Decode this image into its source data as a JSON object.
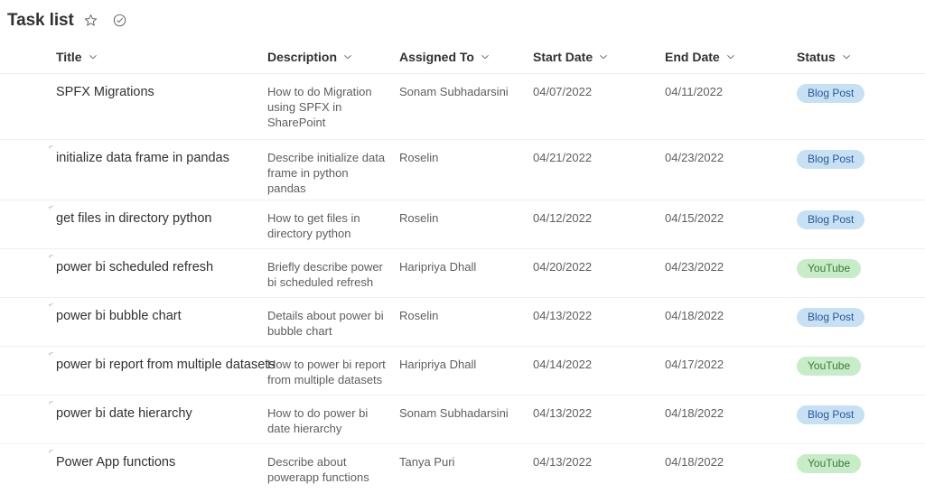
{
  "header": {
    "title": "Task list",
    "favorite_icon": "star-icon",
    "published_icon": "check-circle-icon"
  },
  "table": {
    "columns": [
      {
        "key": "title",
        "label": "Title",
        "sort_icon": "chevron-down-icon"
      },
      {
        "key": "description",
        "label": "Description",
        "sort_icon": "chevron-down-icon"
      },
      {
        "key": "assigned_to",
        "label": "Assigned To",
        "sort_icon": "chevron-down-icon"
      },
      {
        "key": "start_date",
        "label": "Start Date",
        "sort_icon": "chevron-down-icon"
      },
      {
        "key": "end_date",
        "label": "End Date",
        "sort_icon": "chevron-down-icon"
      },
      {
        "key": "status",
        "label": "Status",
        "sort_icon": "chevron-down-icon"
      }
    ],
    "row_marker": "⌐",
    "rows": [
      {
        "title": "SPFX Migrations",
        "has_marker": false,
        "description": "How to do Migration using SPFX in SharePoint",
        "assigned_to": "Sonam Subhadarsini",
        "start_date": "04/07/2022",
        "end_date": "04/11/2022",
        "status": "Blog Post",
        "status_color": "blue"
      },
      {
        "title": "initialize data frame in pandas",
        "has_marker": true,
        "description": "Describe initialize data frame in python pandas",
        "assigned_to": "Roselin",
        "start_date": "04/21/2022",
        "end_date": "04/23/2022",
        "status": "Blog Post",
        "status_color": "blue"
      },
      {
        "title": "get files in directory python",
        "has_marker": true,
        "description": "How to get files in directory python",
        "assigned_to": "Roselin",
        "start_date": "04/12/2022",
        "end_date": "04/15/2022",
        "status": "Blog Post",
        "status_color": "blue"
      },
      {
        "title": "power bi scheduled refresh",
        "has_marker": true,
        "description": "Briefly describe power bi scheduled refresh",
        "assigned_to": "Haripriya Dhall",
        "start_date": "04/20/2022",
        "end_date": "04/23/2022",
        "status": "YouTube",
        "status_color": "green"
      },
      {
        "title": "power bi bubble chart",
        "has_marker": true,
        "description": "Details about power bi bubble chart",
        "assigned_to": "Roselin",
        "start_date": "04/13/2022",
        "end_date": "04/18/2022",
        "status": "Blog Post",
        "status_color": "blue"
      },
      {
        "title": "power bi report from multiple datasets",
        "has_marker": true,
        "description": "How to power bi report from multiple datasets",
        "assigned_to": "Haripriya Dhall",
        "start_date": "04/14/2022",
        "end_date": "04/17/2022",
        "status": "YouTube",
        "status_color": "green"
      },
      {
        "title": "power bi date hierarchy",
        "has_marker": true,
        "description": "How to do power bi date hierarchy",
        "assigned_to": "Sonam Subhadarsini",
        "start_date": "04/13/2022",
        "end_date": "04/18/2022",
        "status": "Blog Post",
        "status_color": "blue"
      },
      {
        "title": "Power App functions",
        "has_marker": true,
        "description": "Describe about powerapp functions",
        "assigned_to": "Tanya Puri",
        "start_date": "04/13/2022",
        "end_date": "04/18/2022",
        "status": "YouTube",
        "status_color": "green"
      }
    ]
  },
  "colors": {
    "text_primary": "#323130",
    "text_secondary": "#605e5c",
    "divider": "#f0f0f0",
    "pill_blue_bg": "#c7e0f4",
    "pill_blue_fg": "#2b5797",
    "pill_green_bg": "#c8ebc8",
    "pill_green_fg": "#3b7a3b"
  }
}
